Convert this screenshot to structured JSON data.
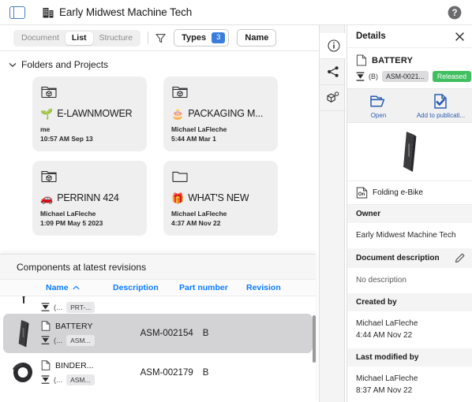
{
  "topbar": {
    "panel_toggle_icon": "sidebar-panel-icon",
    "building_icon": "building-icon",
    "title": "Early Midwest Machine Tech",
    "help_icon": "help-circle-icon"
  },
  "toolbar": {
    "segments": [
      {
        "label": "Document",
        "active": false
      },
      {
        "label": "List",
        "active": true
      },
      {
        "label": "Structure",
        "active": false
      }
    ],
    "filter_icon": "funnel-icon",
    "types_label": "Types",
    "types_count": "3",
    "name_label": "Name"
  },
  "rail": {
    "items": [
      {
        "icon": "info-circle-icon",
        "name": "info",
        "selected": true
      },
      {
        "icon": "share-icon",
        "name": "share",
        "selected": false
      },
      {
        "icon": "cube-badge-icon",
        "name": "parts",
        "selected": false
      }
    ]
  },
  "content": {
    "section_title": "Folders and Projects",
    "cards": [
      {
        "folder_icon": "project-folder-icon",
        "emoji": "🌱",
        "title": "E-LAWNMOWER",
        "owner": "me",
        "timestamp": "10:57 AM Sep 13"
      },
      {
        "folder_icon": "project-folder-icon",
        "emoji": "🎂",
        "title": "PACKAGING M...",
        "owner": "Michael LaFleche",
        "timestamp": "5:44 AM Mar 1"
      },
      {
        "folder_icon": "project-folder-icon",
        "emoji": "🚗",
        "title": "PERRINN 424",
        "owner": "Michael LaFleche",
        "timestamp": "1:09 PM May 5 2023"
      },
      {
        "folder_icon": "plain-folder-icon",
        "emoji": "🎁",
        "title": "WHAT'S NEW",
        "owner": "Michael LaFleche",
        "timestamp": "4:37 AM Nov 22"
      }
    ]
  },
  "components_panel": {
    "title": "Components at latest revisions",
    "columns": {
      "name": "Name",
      "sort_icon": "chevron-up-icon",
      "description": "Description",
      "part_number": "Part number",
      "revision": "Revision"
    },
    "rows": [
      {
        "thumb_icon": "funnel-part-thumb",
        "doc_icon": "document-icon",
        "name": "",
        "rev_icon": "revision-icon",
        "paren": "(...",
        "chip": "PRT-...",
        "part_number": "",
        "revision": "",
        "selected": false,
        "clipped": true
      },
      {
        "thumb_icon": "battery-thumb",
        "doc_icon": "document-icon",
        "name": "BATTERY",
        "rev_icon": "revision-icon",
        "paren": "(...",
        "chip": "ASM...",
        "part_number": "ASM-002154",
        "revision": "B",
        "selected": true,
        "clipped": false
      },
      {
        "thumb_icon": "binder-clip-thumb",
        "doc_icon": "document-icon",
        "name": "BINDER...",
        "rev_icon": "revision-icon",
        "paren": "(...",
        "chip": "ASM...",
        "part_number": "ASM-002179",
        "revision": "B",
        "selected": false,
        "clipped": false
      }
    ]
  },
  "details": {
    "header_title": "Details",
    "close_icon": "close-icon",
    "object_icon": "document-icon",
    "object_name": "BATTERY",
    "revision_icon": "revision-icon",
    "revision_label": "(B)",
    "part_chip": "ASM-0021...",
    "state_badge": "Released",
    "actions": [
      {
        "icon": "open-folder-icon",
        "label": "Open"
      },
      {
        "icon": "add-publication-icon",
        "label": "Add to publicati..."
      }
    ],
    "preview_icon": "battery-preview",
    "parent_icon": "onshape-doc-icon",
    "parent_name": "Folding e-Bike",
    "fields": [
      {
        "label": "Owner",
        "value": "Early Midwest Machine Tech",
        "editable": false
      },
      {
        "label": "Document description",
        "value": "No description",
        "editable": true
      },
      {
        "label": "Created by",
        "value": "Michael LaFleche\n4:44 AM Nov 22",
        "editable": false
      },
      {
        "label": "Last modified by",
        "value": "Michael LaFleche\n8:37 AM Nov 22",
        "editable": false
      }
    ]
  },
  "colors": {
    "accent_blue": "#0a7cff",
    "badge_blue": "#3b7ddd",
    "released_green": "#3fbf5f",
    "link_blue": "#2a5db0",
    "panel_gray": "#efeff0"
  }
}
